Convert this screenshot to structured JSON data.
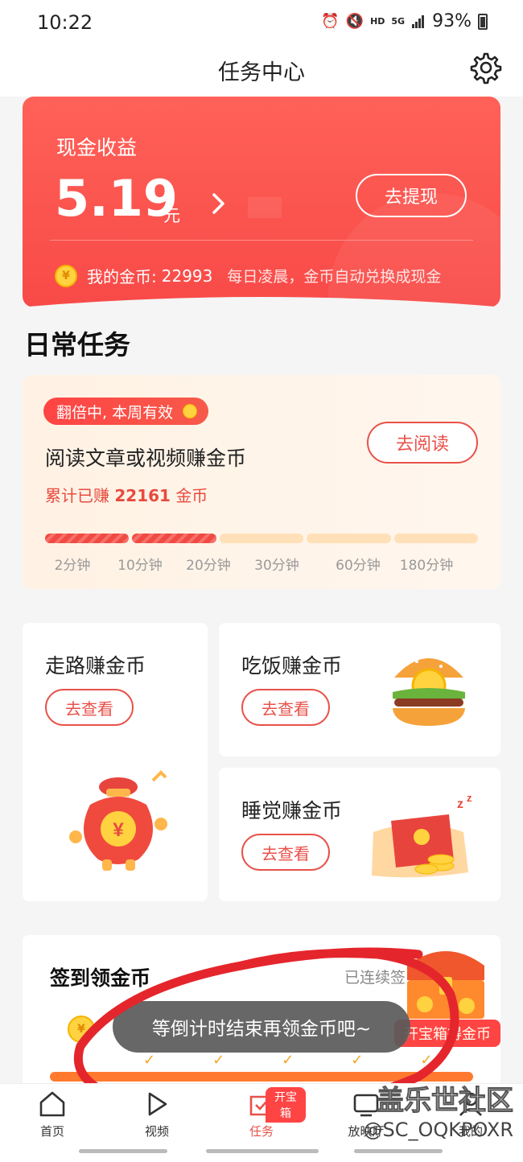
{
  "status_bar": {
    "time": "10:22",
    "network_hd": "HD",
    "network_5g": "5G",
    "battery": "93%"
  },
  "header": {
    "title": "任务中心"
  },
  "cash": {
    "label": "现金收益",
    "amount": "5.19",
    "unit": "元",
    "withdraw_label": "去提现",
    "coin_label": "我的金币:",
    "coin_value": "22993",
    "coin_note": "每日凌晨，金币自动兑换成现金"
  },
  "daily": {
    "title": "日常任务",
    "read": {
      "badge": "翻倍中, 本周有效",
      "task": "阅读文章或视频赚金币",
      "earned_prefix": "累计已赚",
      "earned_value": "22161",
      "earned_suffix": "金币",
      "button": "去阅读",
      "progress_fraction": 0.4,
      "ticks": [
        "2分钟",
        "10分钟",
        "20分钟",
        "30分钟",
        "60分钟",
        "180分钟"
      ]
    },
    "walk": {
      "name": "走路赚金币",
      "button": "去查看"
    },
    "eat": {
      "name": "吃饭赚金币",
      "button": "去查看"
    },
    "sleep": {
      "name": "睡觉赚金币",
      "button": "去查看"
    }
  },
  "signin": {
    "title": "签到领金币",
    "consecutive": "已连续签",
    "chest_tag": "开宝箱得金币",
    "checks": "✓✓✓✓✓"
  },
  "toast": "等倒计时结束再领金币吧~",
  "nav": {
    "home": "首页",
    "video": "视频",
    "task": "任务",
    "task_badge": "开宝箱",
    "hall": "放映厅",
    "me": "我的"
  },
  "watermark": {
    "main": "盖乐世社区",
    "sub": "@SC_OQKPOXR"
  },
  "colors": {
    "accent": "#e8514a",
    "card_red": "#f84a48",
    "coin_gold": "#ffd23f"
  }
}
